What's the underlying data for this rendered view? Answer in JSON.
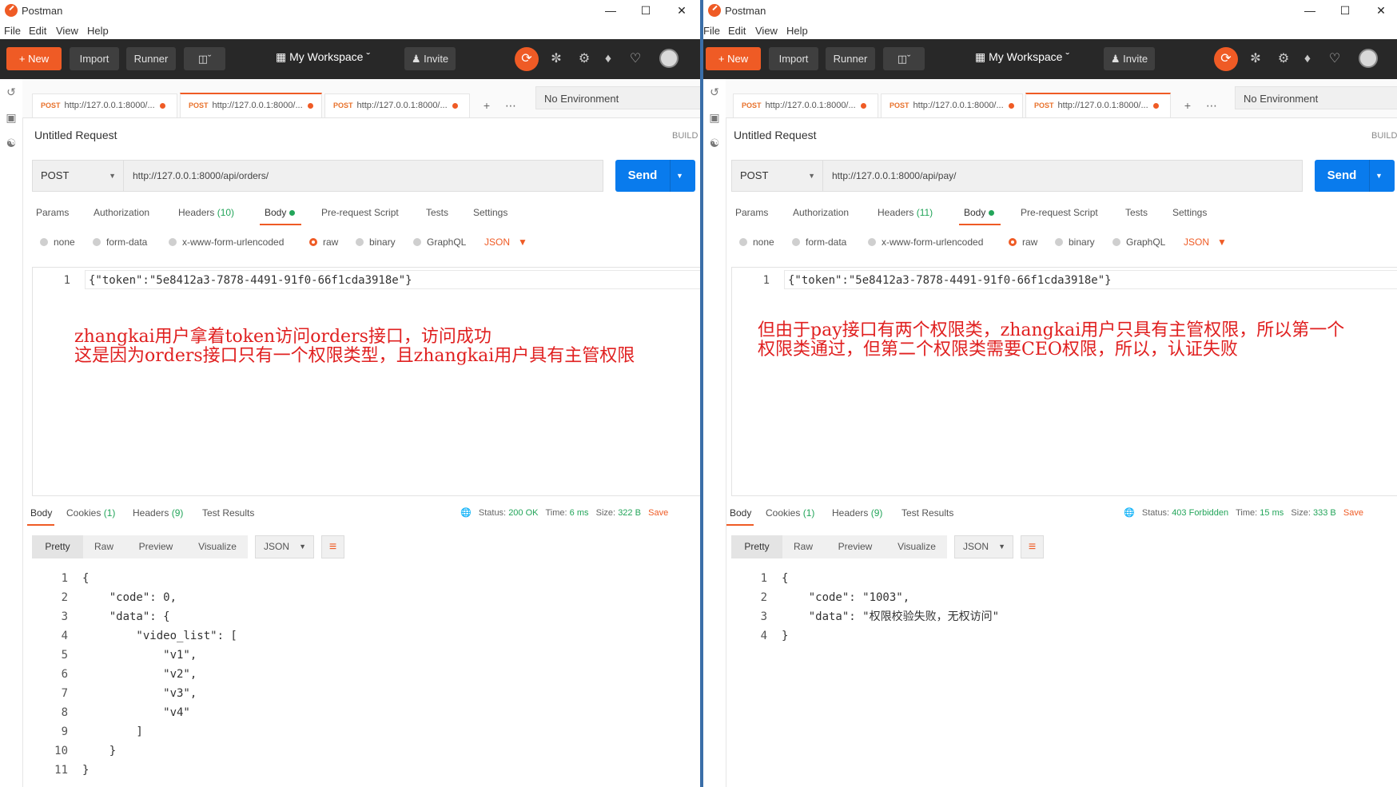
{
  "app": {
    "title": "Postman"
  },
  "menu": [
    "File",
    "Edit",
    "View",
    "Help"
  ],
  "toolbar": {
    "new": "New",
    "import": "Import",
    "runner": "Runner",
    "workspace": "My Workspace",
    "invite": "Invite"
  },
  "environment": "No Environment",
  "request": {
    "title": "Untitled Request",
    "build": "BUILD",
    "send": "Send"
  },
  "req_tabs": {
    "params": "Params",
    "authorization": "Authorization",
    "headers": "Headers",
    "body": "Body",
    "prerequest": "Pre-request Script",
    "tests": "Tests",
    "settings": "Settings"
  },
  "body_types": [
    "none",
    "form-data",
    "x-www-form-urlencoded",
    "raw",
    "binary",
    "GraphQL",
    "JSON"
  ],
  "res_tabs": {
    "body": "Body",
    "cookies": "Cookies",
    "cookies_count": "(1)",
    "headers": "Headers",
    "headers_count": "(9)",
    "test_results": "Test Results"
  },
  "res_labels": {
    "status": "Status:",
    "time": "Time:",
    "size": "Size:",
    "save": "Save"
  },
  "view_modes": [
    "Pretty",
    "Raw",
    "Preview",
    "Visualize",
    "JSON"
  ],
  "left": {
    "tabs": [
      {
        "method": "POST",
        "url": "http://127.0.0.1:8000/..."
      },
      {
        "method": "POST",
        "url": "http://127.0.0.1:8000/..."
      },
      {
        "method": "POST",
        "url": "http://127.0.0.1:8000/..."
      }
    ],
    "method": "POST",
    "url": "http://127.0.0.1:8000/api/orders/",
    "headers_count": "(10)",
    "request_body": "{\"token\":\"5e8412a3-7878-4491-91f0-66f1cda3918e\"}",
    "annotation": [
      "zhangkai用户拿着token访问orders接口，访问成功",
      "这是因为orders接口只有一个权限类型，且zhangkai用户具有主管权限"
    ],
    "status": "200 OK",
    "time": "6 ms",
    "size": "322 B",
    "response_lines": [
      "{",
      "    \"code\": 0,",
      "    \"data\": {",
      "        \"video_list\": [",
      "            \"v1\",",
      "            \"v2\",",
      "            \"v3\",",
      "            \"v4\"",
      "        ]",
      "    }",
      "}"
    ]
  },
  "right": {
    "tabs": [
      {
        "method": "POST",
        "url": "http://127.0.0.1:8000/..."
      },
      {
        "method": "POST",
        "url": "http://127.0.0.1:8000/..."
      },
      {
        "method": "POST",
        "url": "http://127.0.0.1:8000/..."
      }
    ],
    "method": "POST",
    "url": "http://127.0.0.1:8000/api/pay/",
    "headers_count": "(11)",
    "request_body": "{\"token\":\"5e8412a3-7878-4491-91f0-66f1cda3918e\"}",
    "annotation": [
      "但由于pay接口有两个权限类，zhangkai用户只具有主管权限，所以第一个",
      "权限类通过，但第二个权限类需要CEO权限，所以，认证失败"
    ],
    "status": "403 Forbidden",
    "time": "15 ms",
    "size": "333 B",
    "response_lines": [
      "{",
      "    \"code\": \"1003\",",
      "    \"data\": \"权限校验失败，无权访问\"",
      "}"
    ]
  },
  "colors": {
    "accent": "#ef5b25",
    "send": "#097bed",
    "toolbar": "#282828",
    "annotation": "#e02020",
    "success": "#23a55a"
  }
}
